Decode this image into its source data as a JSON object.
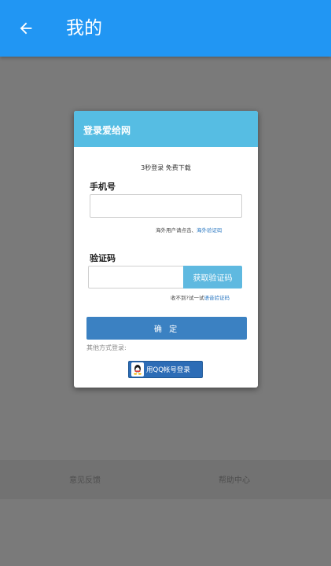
{
  "appbar": {
    "title": "我的",
    "back_icon": "arrow-left-icon"
  },
  "dialog": {
    "title": "登录爱给网",
    "tagline": "3秒登录 免费下载",
    "phone_label": "手机号",
    "phone_value": "",
    "overseas_hint": "海外用户请点击、",
    "overseas_link": "海外验证码",
    "code_label": "验证码",
    "code_value": "",
    "get_code_button": "获取验证码",
    "voice_hint": "收不到?试一试",
    "voice_link": "语音验证码",
    "confirm_button": "确 定",
    "other_methods_label": "其他方式登录:",
    "qq_login_button": "用QQ帐号登录",
    "qq_icon": "qq-penguin-icon"
  },
  "footer": {
    "feedback": "意见反馈",
    "help": "帮助中心"
  },
  "colors": {
    "appbar": "#2196f3",
    "dialog_header": "#56bde3",
    "confirm": "#3b81c2",
    "link": "#2b78c2"
  }
}
